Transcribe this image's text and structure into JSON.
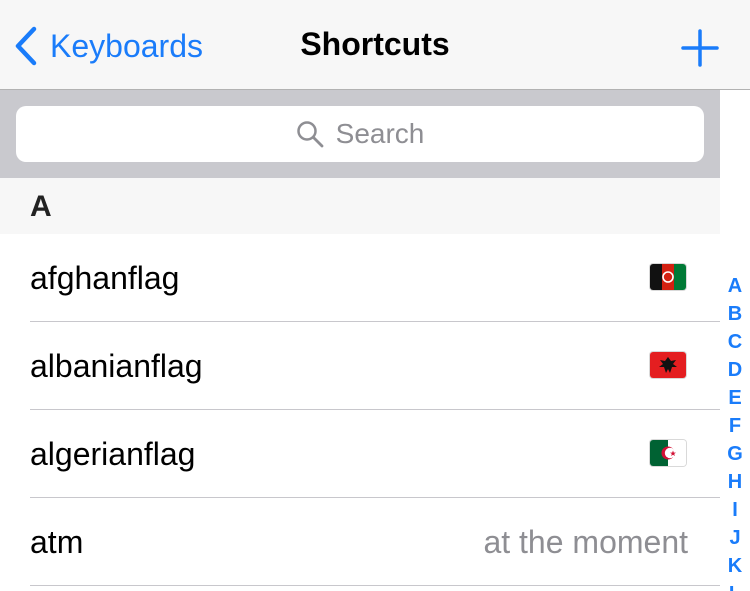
{
  "navbar": {
    "back_label": "Keyboards",
    "title": "Shortcuts",
    "add_icon": "plus-icon",
    "back_icon": "chevron-left-icon"
  },
  "search": {
    "placeholder": "Search",
    "icon": "search-icon"
  },
  "section": {
    "header": "A"
  },
  "rows": [
    {
      "shortcut": "afghanflag",
      "phrase": "",
      "flag_icon": "afghanistan-flag-icon"
    },
    {
      "shortcut": "albanianflag",
      "phrase": "",
      "flag_icon": "albania-flag-icon"
    },
    {
      "shortcut": "algerianflag",
      "phrase": "",
      "flag_icon": "algeria-flag-icon"
    },
    {
      "shortcut": "atm",
      "phrase": "at the moment",
      "flag_icon": ""
    }
  ],
  "index": [
    "A",
    "B",
    "C",
    "D",
    "E",
    "F",
    "G",
    "H",
    "I",
    "J",
    "K",
    "L"
  ],
  "colors": {
    "accent": "#1a7cfa",
    "navbar_bg": "#f7f7f7",
    "search_bg": "#c9c9ce",
    "secondary_text": "#8e8e93"
  }
}
